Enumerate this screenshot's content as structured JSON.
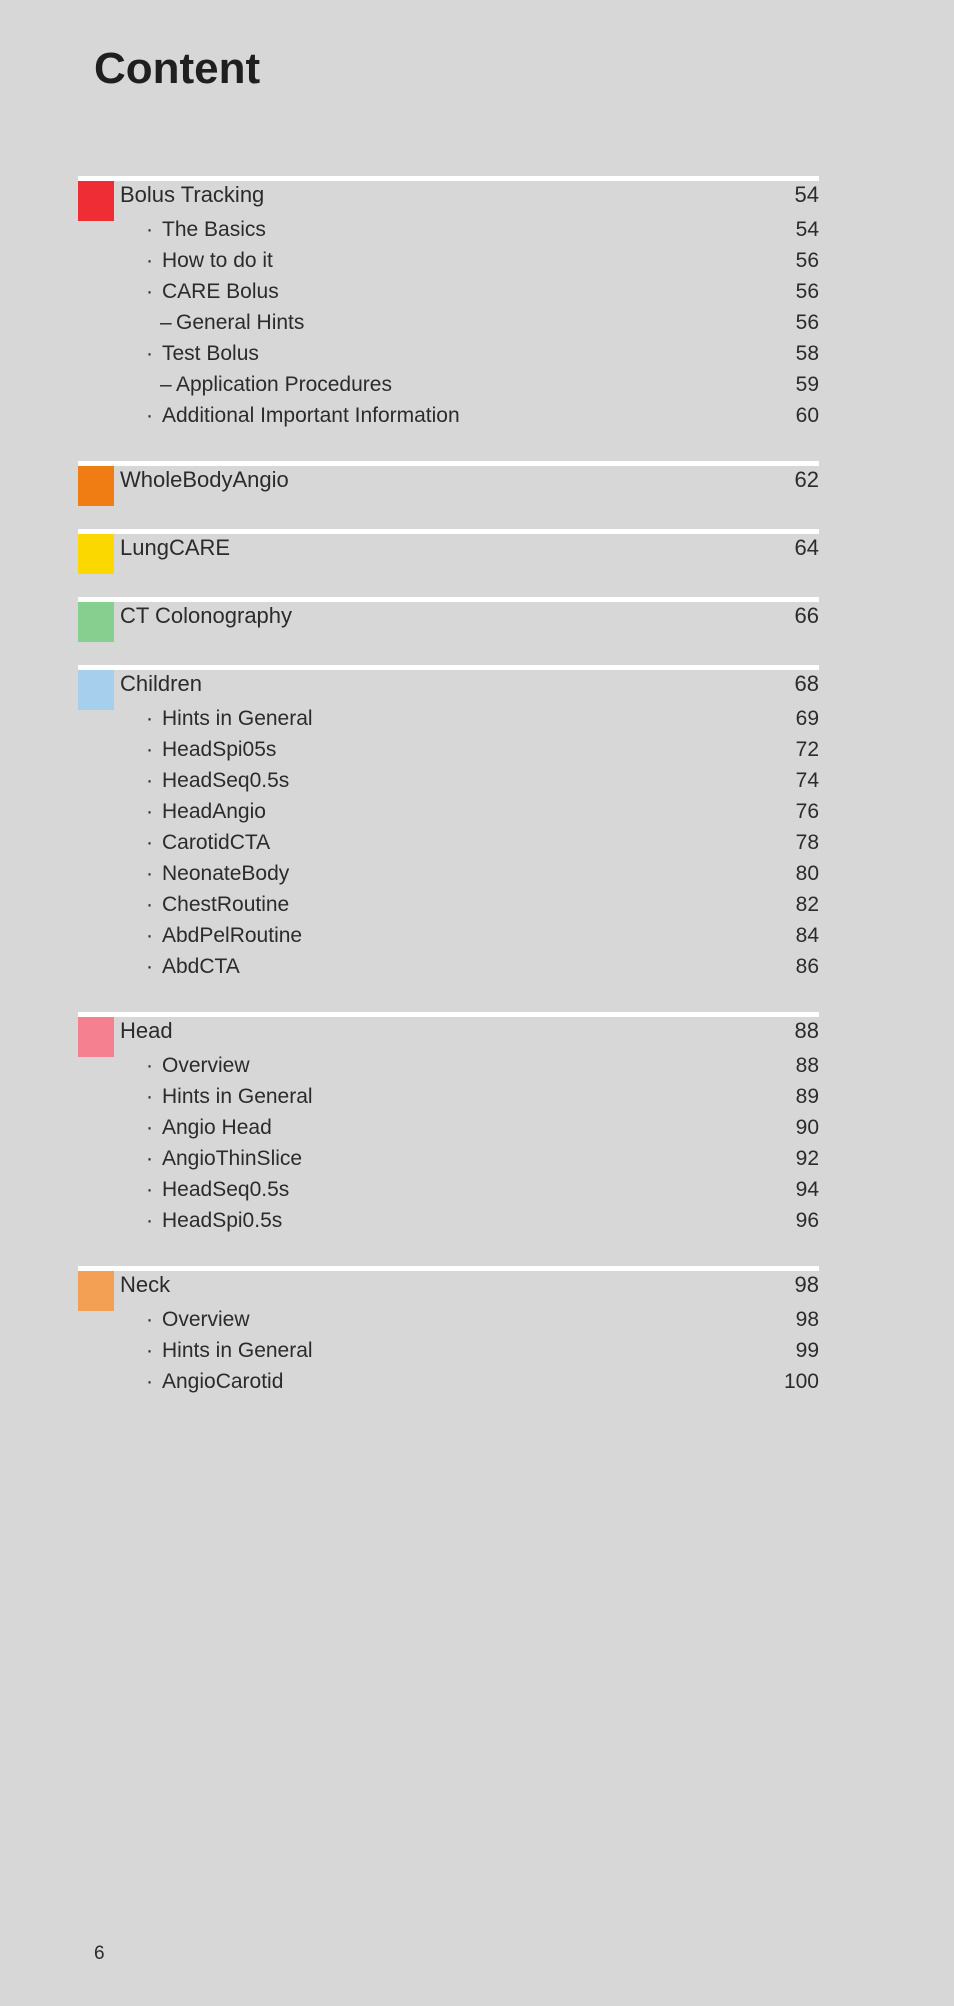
{
  "document": {
    "title": "Content",
    "folio": "6",
    "background_color": "#d7d7d7",
    "rule_color": "#ffffff",
    "text_color": "#2b2b2b"
  },
  "sections": [
    {
      "color": "#ee2e34",
      "color_name": "red",
      "title": "Bolus Tracking",
      "page": "54",
      "entries": [
        {
          "level": 1,
          "bullet": "·",
          "label": "The Basics",
          "page": "54"
        },
        {
          "level": 1,
          "bullet": "·",
          "label": "How to do it",
          "page": "56"
        },
        {
          "level": 1,
          "bullet": "·",
          "label": "CARE  Bolus",
          "page": "56"
        },
        {
          "level": 2,
          "bullet": "–",
          "label": "General Hints",
          "page": "56"
        },
        {
          "level": 1,
          "bullet": "·",
          "label": "Test Bolus",
          "page": "58"
        },
        {
          "level": 2,
          "bullet": "–",
          "label": "Application Procedures",
          "page": "59"
        },
        {
          "level": 1,
          "bullet": "·",
          "label": "Additional Important Information",
          "page": "60"
        }
      ]
    },
    {
      "color": "#f07d14",
      "color_name": "orange",
      "title": "WholeBodyAngio",
      "page": "62",
      "entries": []
    },
    {
      "color": "#fad800",
      "color_name": "yellow",
      "title": "LungCARE",
      "page": "64",
      "entries": []
    },
    {
      "color": "#86cf8e",
      "color_name": "green",
      "title": "CT Colonography",
      "page": "66",
      "entries": []
    },
    {
      "color": "#a6cfee",
      "color_name": "light-blue",
      "title": "Children",
      "page": "68",
      "entries": [
        {
          "level": 1,
          "bullet": "·",
          "label": "Hints in General",
          "page": "69"
        },
        {
          "level": 1,
          "bullet": "·",
          "label": "HeadSpi05s",
          "page": "72"
        },
        {
          "level": 1,
          "bullet": "·",
          "label": "HeadSeq0.5s",
          "page": "74"
        },
        {
          "level": 1,
          "bullet": "·",
          "label": "HeadAngio",
          "page": "76"
        },
        {
          "level": 1,
          "bullet": "·",
          "label": "CarotidCTA",
          "page": "78"
        },
        {
          "level": 1,
          "bullet": "·",
          "label": "NeonateBody",
          "page": "80"
        },
        {
          "level": 1,
          "bullet": "·",
          "label": "ChestRoutine",
          "page": "82"
        },
        {
          "level": 1,
          "bullet": "·",
          "label": "AbdPelRoutine",
          "page": "84"
        },
        {
          "level": 1,
          "bullet": "·",
          "label": "AbdCTA",
          "page": "86"
        }
      ]
    },
    {
      "color": "#f58090",
      "color_name": "pink",
      "title": "Head",
      "page": "88",
      "entries": [
        {
          "level": 1,
          "bullet": "·",
          "label": "Overview",
          "page": "88"
        },
        {
          "level": 1,
          "bullet": "·",
          "label": "Hints in General",
          "page": "89"
        },
        {
          "level": 1,
          "bullet": "·",
          "label": "Angio Head",
          "page": "90"
        },
        {
          "level": 1,
          "bullet": "·",
          "label": "AngioThinSlice",
          "page": "92"
        },
        {
          "level": 1,
          "bullet": "·",
          "label": "HeadSeq0.5s",
          "page": "94"
        },
        {
          "level": 1,
          "bullet": "·",
          "label": "HeadSpi0.5s",
          "page": "96"
        }
      ]
    },
    {
      "color": "#f3a055",
      "color_name": "light-orange",
      "title": "Neck",
      "page": "98",
      "entries": [
        {
          "level": 1,
          "bullet": "·",
          "label": "Overview",
          "page": "98"
        },
        {
          "level": 1,
          "bullet": "·",
          "label": "Hints in General",
          "page": "99"
        },
        {
          "level": 1,
          "bullet": "·",
          "label": "AngioCarotid",
          "page": "100"
        }
      ]
    }
  ]
}
